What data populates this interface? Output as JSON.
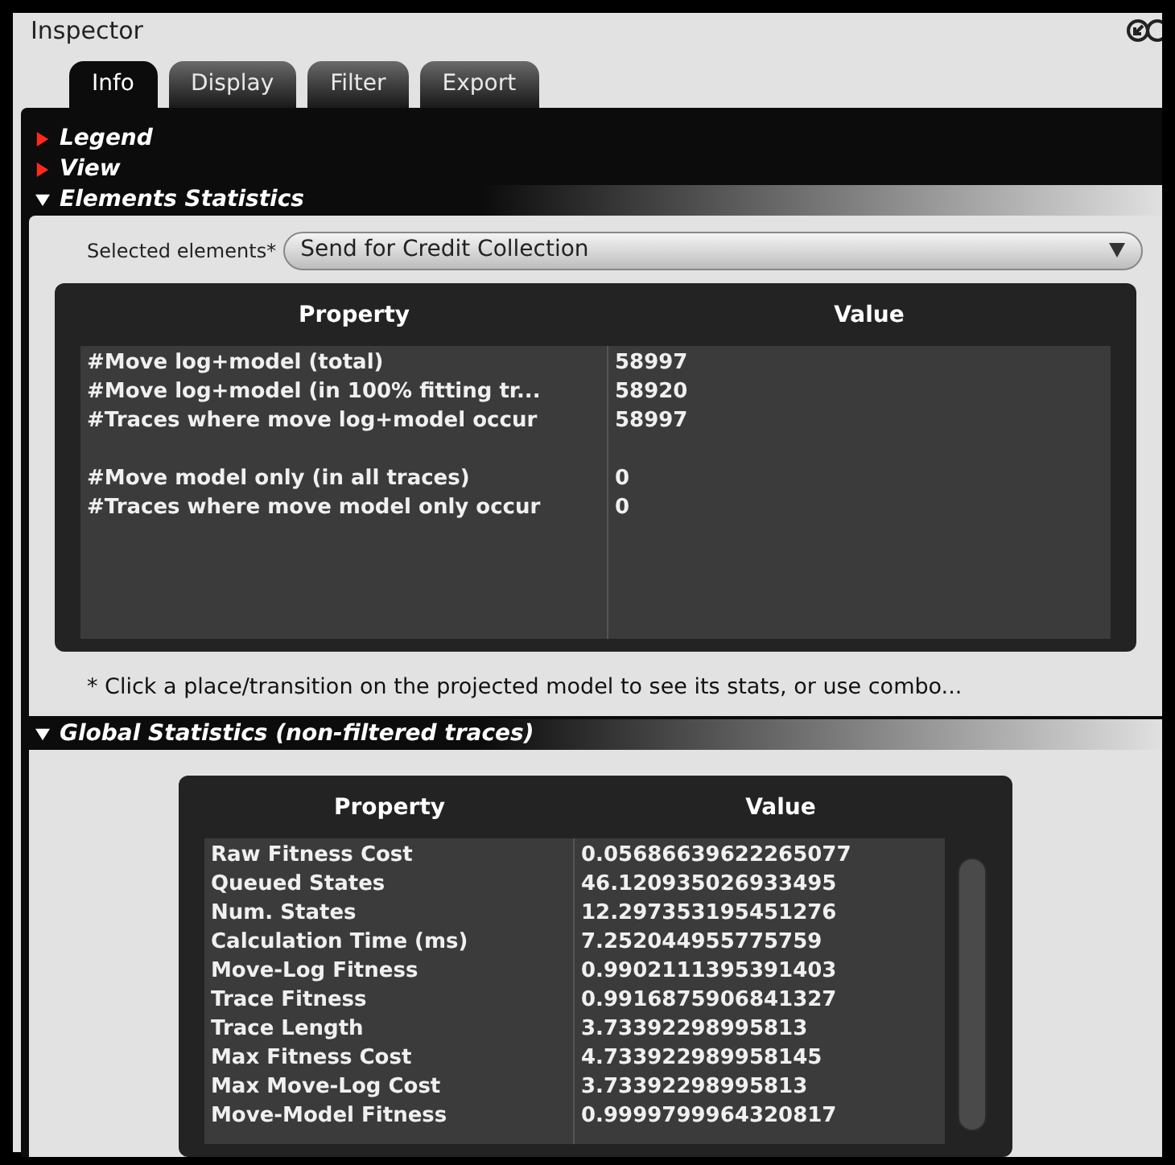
{
  "window": {
    "title": "Inspector"
  },
  "tabs": [
    {
      "label": "Info",
      "selected": true
    },
    {
      "label": "Display",
      "selected": false
    },
    {
      "label": "Filter",
      "selected": false
    },
    {
      "label": "Export",
      "selected": false
    }
  ],
  "sections": [
    {
      "title": "Legend",
      "expanded": false
    },
    {
      "title": "View",
      "expanded": false
    },
    {
      "title": "Elements Statistics",
      "expanded": true,
      "selector": {
        "label": "Selected elements*",
        "value": "Send for Credit Collection"
      },
      "table": {
        "columns": [
          "Property",
          "Value"
        ],
        "groups": [
          [
            {
              "property": "#Move log+model (total)",
              "value": "58997"
            },
            {
              "property": "#Move log+model (in 100% fitting tr...",
              "value": "58920"
            },
            {
              "property": "#Traces where move log+model occur",
              "value": "58997"
            }
          ],
          [
            {
              "property": "#Move model only (in all traces)",
              "value": "0"
            },
            {
              "property": "#Traces where move model only occur",
              "value": "0"
            }
          ]
        ]
      },
      "note": "* Click a place/transition on the projected model to see its stats, or use combo..."
    },
    {
      "title": "Global Statistics (non-filtered traces)",
      "expanded": true,
      "table": {
        "columns": [
          "Property",
          "Value"
        ],
        "groups": [
          [
            {
              "property": "Raw Fitness Cost",
              "value": "0.05686639622265077"
            },
            {
              "property": "Queued States",
              "value": "46.120935026933495"
            },
            {
              "property": "Num. States",
              "value": "12.297353195451276"
            },
            {
              "property": "Calculation Time (ms)",
              "value": "7.252044955775759"
            },
            {
              "property": "Move-Log Fitness",
              "value": "0.9902111395391403"
            },
            {
              "property": "Trace Fitness",
              "value": "0.9916875906841327"
            },
            {
              "property": "Trace Length",
              "value": "3.73392298995813"
            },
            {
              "property": "Max Fitness Cost",
              "value": "4.733922989958145"
            },
            {
              "property": "Max Move-Log Cost",
              "value": "3.73392298995813"
            },
            {
              "property": "Move-Model Fitness",
              "value": "0.9999799964320817"
            }
          ]
        ]
      }
    }
  ]
}
